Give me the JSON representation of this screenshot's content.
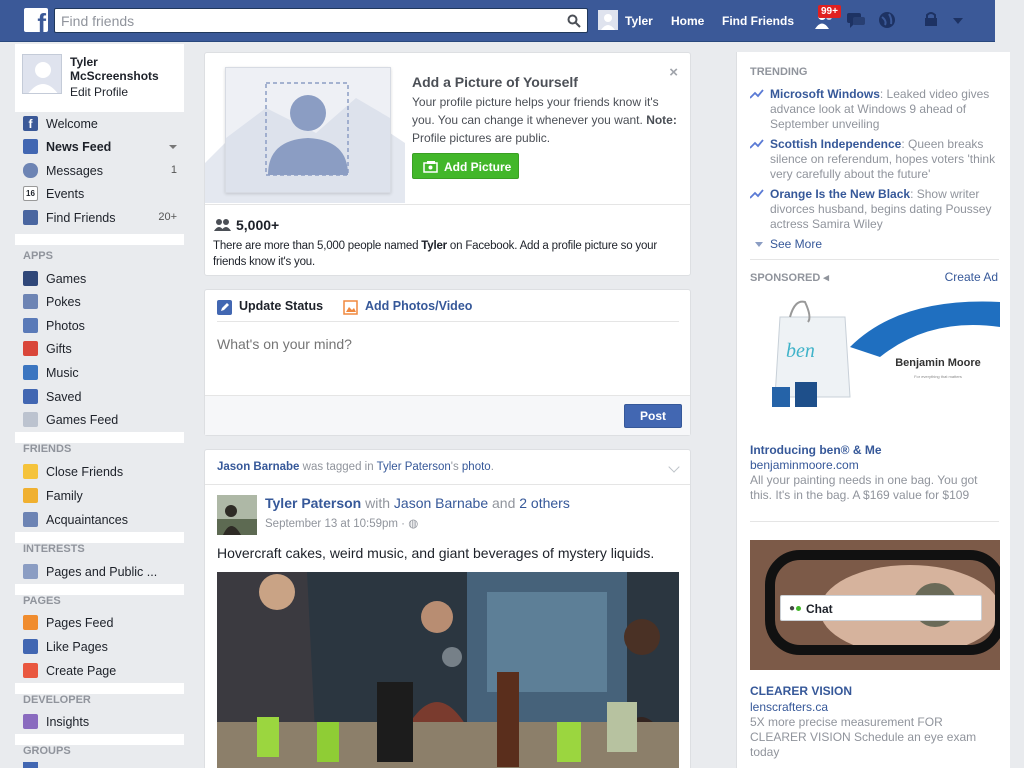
{
  "topbar": {
    "logo": "f",
    "search_placeholder": "Find friends",
    "user": "Tyler",
    "home": "Home",
    "find_friends": "Find Friends",
    "notifications": "99+"
  },
  "left": {
    "profile_name": "Tyler McScreenshots",
    "edit_profile": "Edit Profile",
    "favorites": [
      {
        "label": "Welcome",
        "count": ""
      },
      {
        "label": "News Feed",
        "count": ""
      },
      {
        "label": "Messages",
        "count": "1"
      },
      {
        "label": "Events",
        "count": ""
      },
      {
        "label": "Find Friends",
        "count": "20+"
      }
    ],
    "apps_header": "APPS",
    "apps": [
      "Games",
      "Pokes",
      "Photos",
      "Gifts",
      "Music",
      "Saved",
      "Games Feed"
    ],
    "friends_header": "FRIENDS",
    "friends": [
      "Close Friends",
      "Family",
      "Acquaintances"
    ],
    "interests_header": "INTERESTS",
    "interests": [
      "Pages and Public ..."
    ],
    "pages_header": "PAGES",
    "pages": [
      "Pages Feed",
      "Like Pages",
      "Create Page"
    ],
    "developer_header": "DEVELOPER",
    "developer": [
      "Insights"
    ],
    "groups_header": "GROUPS"
  },
  "add_picture": {
    "title": "Add a Picture of Yourself",
    "desc": "Your profile picture helps your friends know it's you. You can change it whenever you want.",
    "note_label": "Note:",
    "note_text": " Profile pictures are public.",
    "button": "Add Picture",
    "close": "×",
    "people_count": "5,000+",
    "people_desc_1": "There are more than 5,000 people named ",
    "people_name": "Tyler",
    "people_desc_2": " on Facebook. Add a profile picture so your friends know it's you."
  },
  "composer": {
    "tab_status": "Update Status",
    "tab_photos": "Add Photos/Video",
    "placeholder": "What's on your mind?",
    "post": "Post"
  },
  "story": {
    "tagger": "Jason Barnabe",
    "tagged_text": " was tagged in ",
    "owner_possessive": "Tyler Paterson",
    "photo_suffix": "'s ",
    "photo_word": "photo",
    "period": ".",
    "author": "Tyler Paterson",
    "with_text": " with ",
    "with_name": "Jason Barnabe",
    "and_text": " and ",
    "others": "2 others",
    "time": "September 13 at 10:59pm · ",
    "text": "Hovercraft cakes, weird music, and giant beverages of mystery liquids."
  },
  "right": {
    "trending_header": "TRENDING",
    "trends": [
      {
        "topic": "Microsoft Windows",
        "desc": ": Leaked video gives advance look at Windows 9 ahead of September unveiling"
      },
      {
        "topic": "Scottish Independence",
        "desc": ": Queen breaks silence on referendum, hopes voters 'think very carefully about the future'"
      },
      {
        "topic": "Orange Is the New Black",
        "desc": ": Show writer divorces husband, begins dating Poussey actress Samira Wiley"
      }
    ],
    "see_more": "See More",
    "sponsored_header": "SPONSORED",
    "create_ad": "Create Ad",
    "ads": [
      {
        "title": "Introducing ben® & Me",
        "url": "benjaminmoore.com",
        "desc": "All your painting needs in one bag. You got this. It's in the bag. A $169 value for $109",
        "brand": "Benjamin Moore",
        "tagline": "For everything that matters",
        "bag_text": "ben"
      },
      {
        "title": "CLEARER VISION",
        "url": "lenscrafters.ca",
        "desc": "5X more precise measurement FOR CLEARER VISION Schedule an eye exam today"
      }
    ],
    "chat": "Chat"
  }
}
